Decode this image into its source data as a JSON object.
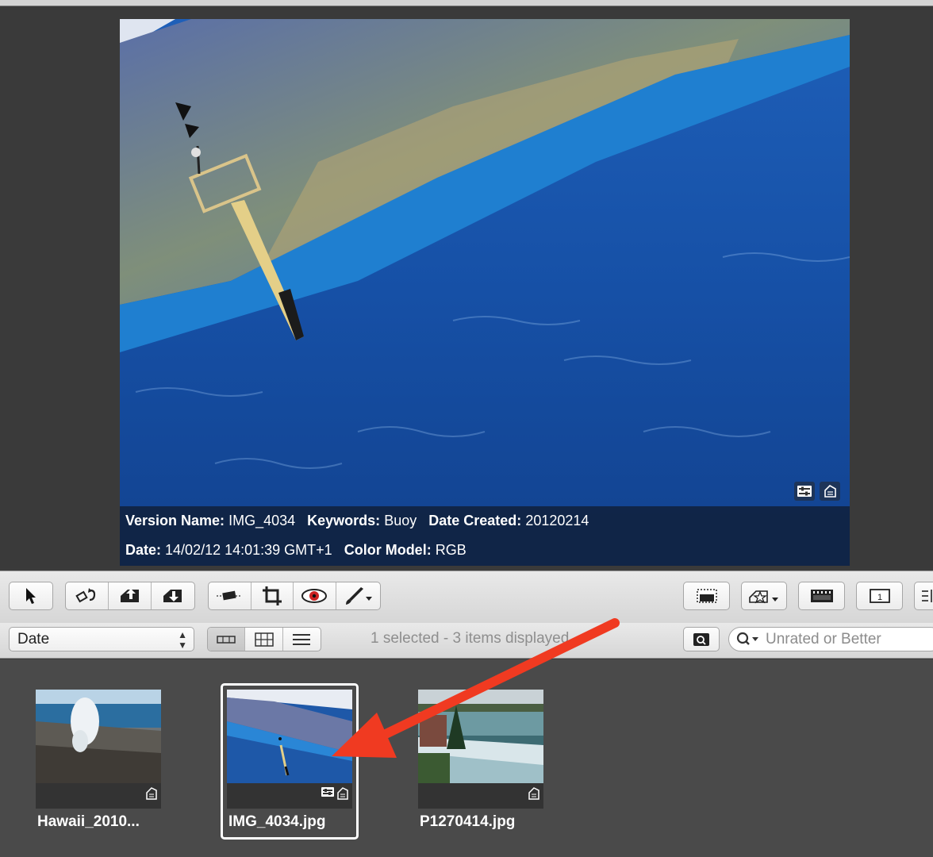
{
  "viewer": {
    "metadata": {
      "version_name_label": "Version Name:",
      "version_name": "IMG_4034",
      "keywords_label": "Keywords:",
      "keywords": "Buoy",
      "date_created_label": "Date Created:",
      "date_created": "20120214",
      "date_label": "Date:",
      "date": "14/02/12 14:01:39 GMT+1",
      "color_model_label": "Color Model:",
      "color_model": "RGB"
    },
    "badges": [
      "adjustments-icon",
      "metadata-tag-icon"
    ]
  },
  "toolbar": {
    "tools": [
      "select-tool",
      "rotate-left-tool",
      "lift-tool",
      "stamp-tool",
      "straighten-tool",
      "crop-tool",
      "red-eye-tool",
      "brush-tool"
    ],
    "right_tools": [
      "viewer-mode",
      "rating-menu",
      "filmstrip-view",
      "single-view",
      "list-view"
    ]
  },
  "browser_bar": {
    "sort_value": "Date",
    "view_modes": [
      "filmstrip",
      "grid",
      "list"
    ],
    "active_view": "filmstrip",
    "status": "1 selected - 3 items displayed",
    "filter_placeholder": "Unrated or Better"
  },
  "thumbnails": [
    {
      "name": "Hawaii_2010...",
      "selected": false,
      "badges": [
        "metadata-tag-icon"
      ]
    },
    {
      "name": "IMG_4034.jpg",
      "selected": true,
      "badges": [
        "adjustments-icon",
        "metadata-tag-icon"
      ]
    },
    {
      "name": "P1270414.jpg",
      "selected": false,
      "badges": [
        "metadata-tag-icon"
      ]
    }
  ],
  "colors": {
    "annotation_arrow": "#f03a21",
    "selection_border": "#ffffff"
  }
}
